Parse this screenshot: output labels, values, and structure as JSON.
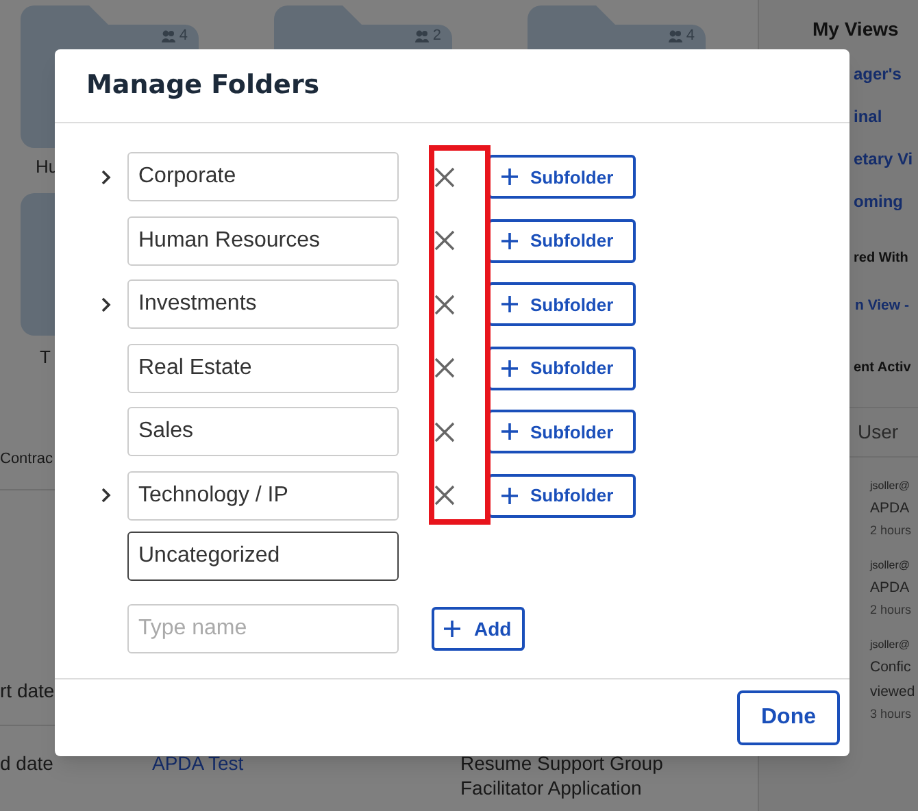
{
  "background": {
    "folder_counts": [
      "4",
      "2",
      "4"
    ],
    "folder_labels": [
      "Hu",
      "T"
    ],
    "tab_label": "Contrac",
    "field_labels": [
      "rt date",
      "d date"
    ],
    "table_row": {
      "name": "APDA Test",
      "title": "Resume Support Group Facilitator Application"
    },
    "side_panel": {
      "title": "My Views",
      "views": [
        "ager's",
        "inal",
        "etary Vi",
        "oming"
      ],
      "shared_title": "red With",
      "shared_views": [
        "n View -"
      ],
      "activity_title": "ent Activ",
      "activity_column": "User",
      "activity": [
        {
          "user": "jsoller@",
          "lines": [
            "APDA"
          ],
          "time": "2 hours"
        },
        {
          "user": "jsoller@",
          "lines": [
            "APDA"
          ],
          "time": "2 hours"
        },
        {
          "user": "jsoller@",
          "lines": [
            "Confic",
            "viewed"
          ],
          "time": "3 hours"
        }
      ]
    }
  },
  "dialog": {
    "title": "Manage Folders",
    "highlight_remove_column": true,
    "folders": [
      {
        "name": "Corporate",
        "expandable": true,
        "removable": true,
        "action": "Subfolder",
        "focused": false
      },
      {
        "name": "Human Resources",
        "expandable": false,
        "removable": true,
        "action": "Subfolder",
        "focused": false
      },
      {
        "name": "Investments",
        "expandable": true,
        "removable": true,
        "action": "Subfolder",
        "focused": false
      },
      {
        "name": "Real Estate",
        "expandable": false,
        "removable": true,
        "action": "Subfolder",
        "focused": false
      },
      {
        "name": "Sales",
        "expandable": false,
        "removable": true,
        "action": "Subfolder",
        "focused": false
      },
      {
        "name": "Technology / IP",
        "expandable": true,
        "removable": true,
        "action": "Subfolder",
        "focused": false
      },
      {
        "name": "Uncategorized",
        "expandable": false,
        "removable": false,
        "focused": true
      }
    ],
    "new_folder": {
      "placeholder": "Type name",
      "action": "Add"
    },
    "done_label": "Done"
  }
}
